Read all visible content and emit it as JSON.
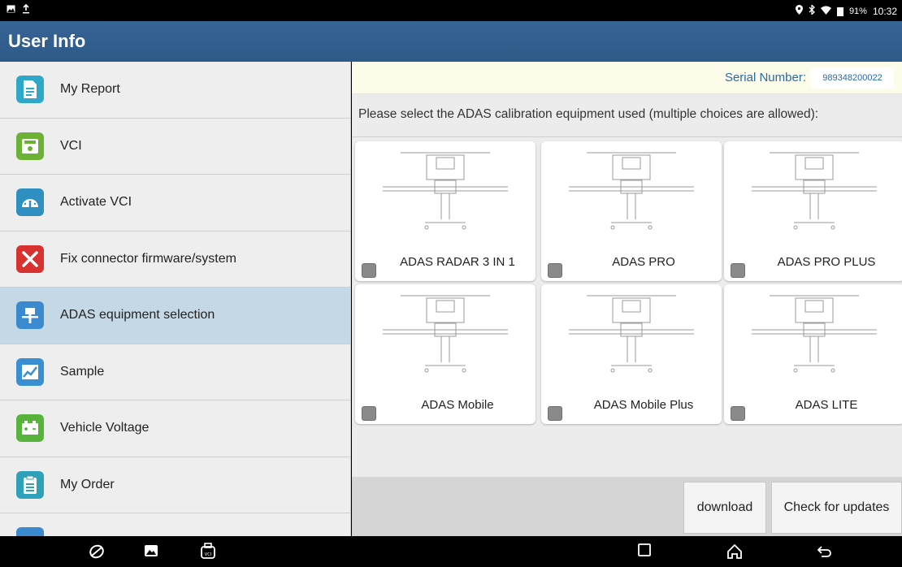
{
  "status_bar": {
    "left_icons": [
      "gallery-icon",
      "upload-icon"
    ],
    "battery": "91%",
    "time": "10:32"
  },
  "title": "User Info",
  "sidebar": {
    "items": [
      {
        "label": "My Report",
        "icon": "report-icon",
        "active": false
      },
      {
        "label": "VCI",
        "icon": "vci-icon",
        "active": false
      },
      {
        "label": "Activate VCI",
        "icon": "gauge-icon",
        "active": false
      },
      {
        "label": "Fix connector firmware/system",
        "icon": "tools-icon",
        "active": false
      },
      {
        "label": "ADAS equipment selection",
        "icon": "adas-icon",
        "active": true
      },
      {
        "label": "Sample",
        "icon": "chart-icon",
        "active": false
      },
      {
        "label": "Vehicle Voltage",
        "icon": "battery-icon",
        "active": false
      },
      {
        "label": "My Order",
        "icon": "clipboard-icon",
        "active": false
      }
    ]
  },
  "main": {
    "serial_label": "Serial Number:",
    "serial_value": "989348200022",
    "instruction": "Please select the ADAS calibration equipment used (multiple choices are allowed):",
    "equipment": [
      {
        "name": "ADAS RADAR 3 IN 1",
        "checked": false
      },
      {
        "name": "ADAS PRO",
        "checked": false
      },
      {
        "name": "ADAS PRO PLUS",
        "checked": false
      },
      {
        "name": "ADAS Mobile",
        "checked": false
      },
      {
        "name": "ADAS Mobile Plus",
        "checked": false
      },
      {
        "name": "ADAS LITE",
        "checked": false
      }
    ],
    "download_label": "download",
    "update_label": "Check for updates"
  },
  "colors": {
    "title_bar": "#366495",
    "active_item": "#c5d8e6",
    "serial_text": "#2a6aa8"
  }
}
